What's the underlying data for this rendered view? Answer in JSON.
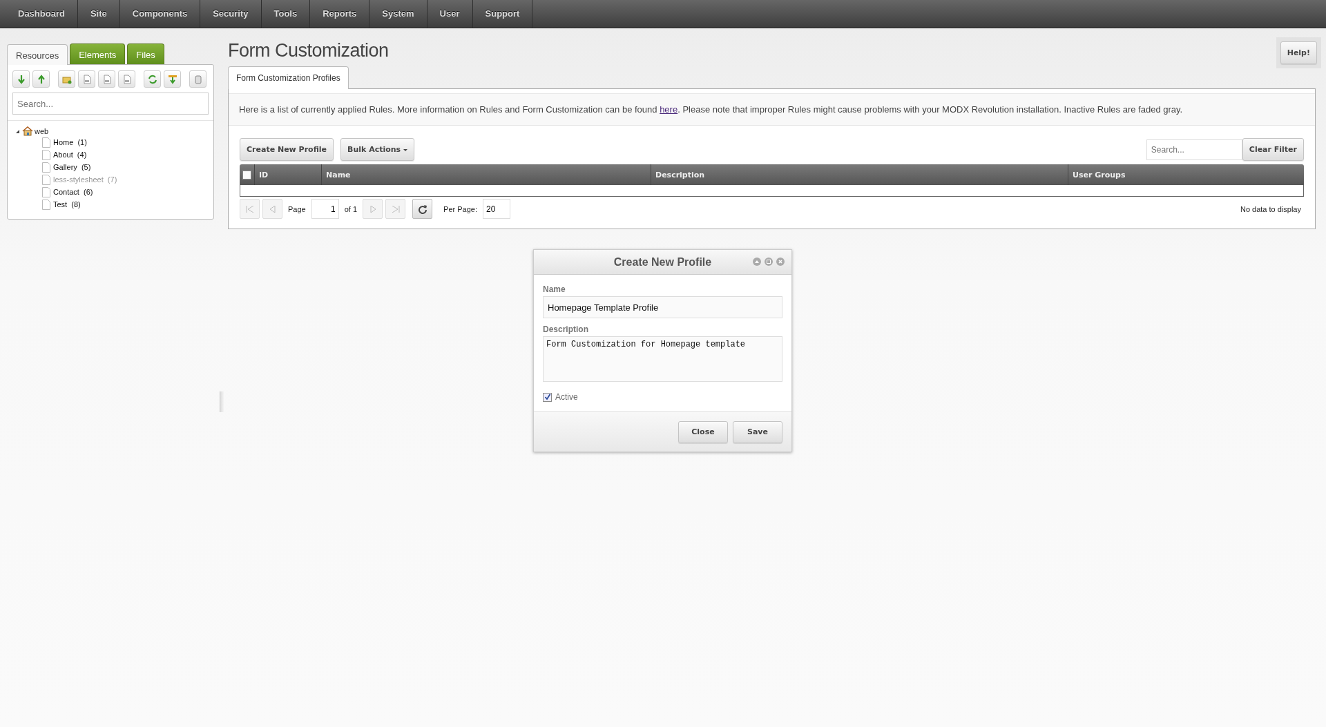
{
  "nav": {
    "items": [
      "Dashboard",
      "Site",
      "Components",
      "Security",
      "Tools",
      "Reports",
      "System",
      "User",
      "Support"
    ]
  },
  "sidebar": {
    "tabs": [
      {
        "label": "Resources",
        "selected": true
      },
      {
        "label": "Elements",
        "selected": false
      },
      {
        "label": "Files",
        "selected": false
      }
    ],
    "search": {
      "placeholder": "Search..."
    },
    "tree": {
      "label": "web",
      "expanded": true,
      "children": [
        {
          "label": "Home  (1)",
          "inactive": false
        },
        {
          "label": "About  (4)",
          "inactive": false
        },
        {
          "label": "Gallery  (5)",
          "inactive": false
        },
        {
          "label": "less-stylesheet  (7)",
          "inactive": true
        },
        {
          "label": "Contact  (6)",
          "inactive": false
        },
        {
          "label": "Test  (8)",
          "inactive": false
        }
      ]
    }
  },
  "main": {
    "title": "Form Customization",
    "help_button": "Help!",
    "tabs": [
      {
        "label": "Form Customization Profiles",
        "selected": true
      }
    ],
    "intro": {
      "before": "Here is a list of currently applied Rules. More information on Rules and Form Customization can be found ",
      "link": "here",
      "after": ". Please note that improper Rules might cause problems with your MODX Revolution installation. Inactive Rules are faded gray."
    },
    "toolbar": {
      "create_button": "Create New Profile",
      "bulk_button": "Bulk Actions",
      "search": {
        "placeholder": "Search..."
      },
      "clear_button": "Clear Filter"
    },
    "table": {
      "select_all_checked": false,
      "columns": [
        "ID",
        "Name",
        "Description",
        "User Groups"
      ]
    },
    "pagination": {
      "page_label": "Page",
      "page": "1",
      "of": "of 1",
      "per_page_label": "Per Page:",
      "per_page": "20",
      "status": "No data to display"
    }
  },
  "dialog": {
    "title": "Create New Profile",
    "name": {
      "label": "Name",
      "value": "Homepage Template Profile"
    },
    "description": {
      "label": "Description",
      "value": "Form Customization for Homepage template"
    },
    "active": {
      "label": "Active",
      "checked": true
    },
    "buttons": [
      "Close",
      "Save"
    ]
  }
}
